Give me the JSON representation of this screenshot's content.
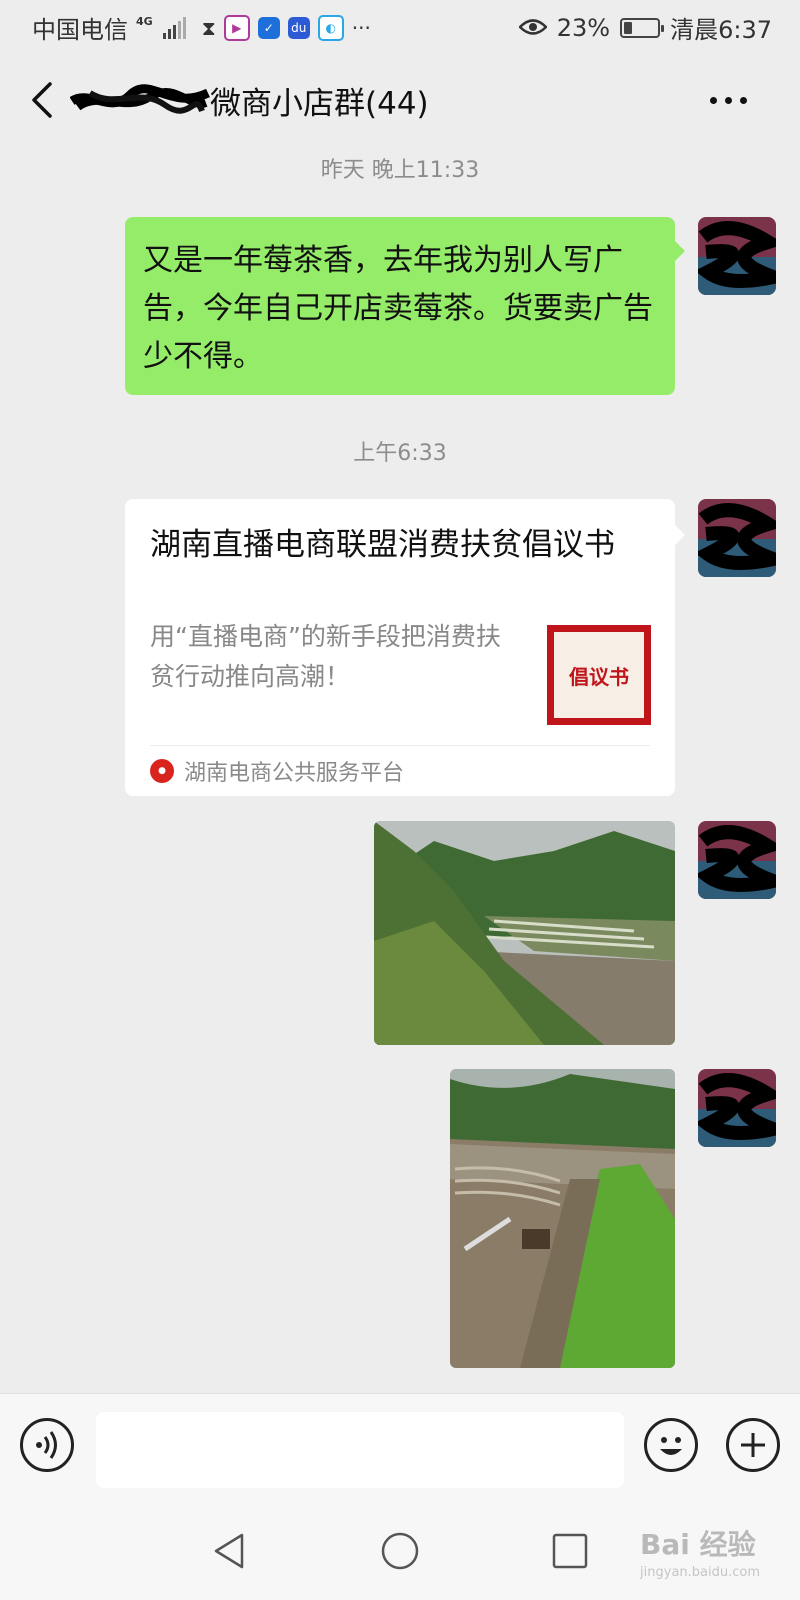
{
  "status_bar": {
    "carrier": "中国电信",
    "network": "4G",
    "battery": "23%",
    "time": "清晨6:37"
  },
  "header": {
    "title": "微商小店群(44)"
  },
  "timestamps": [
    "昨天 晚上11:33",
    "上午6:33"
  ],
  "messages": {
    "text_message": "又是一年莓茶香，去年我为别人写广告，今年自己开店卖莓茶。货要卖广告少不得。",
    "article": {
      "title": "湖南直播电商联盟消费扶贫倡议书",
      "description": "用“直播电商”的新手段把消费扶贫行动推向高潮！",
      "thumbnail_text": "倡议书",
      "source": "湖南电商公共服务平台"
    }
  },
  "watermark": {
    "brand": "Bai 经验",
    "url": "jingyan.baidu.com"
  },
  "colors": {
    "background": "#ededed",
    "sent_bubble": "#95ec69",
    "card": "#ffffff",
    "timestamp": "#8c8c8c"
  }
}
